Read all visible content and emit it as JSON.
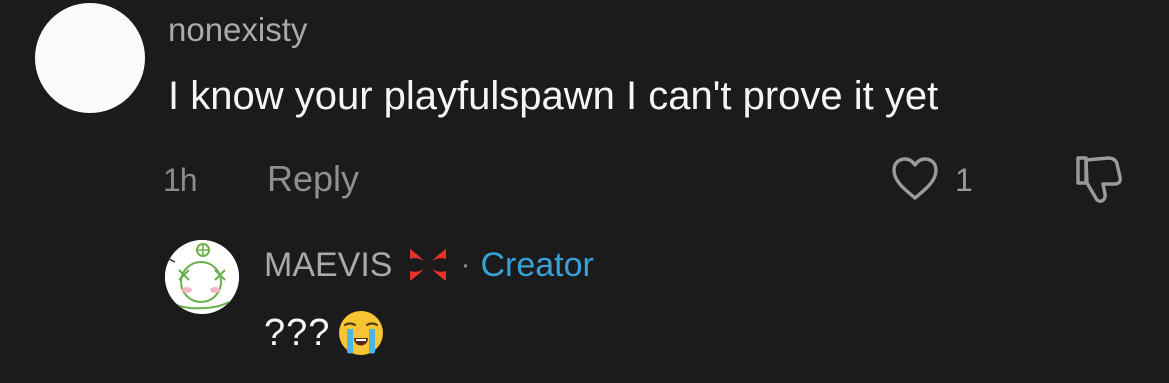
{
  "comment": {
    "username": "nonexisty",
    "text": "I know your playfulspawn I can't prove it yet",
    "time": "1h",
    "reply_label": "Reply",
    "like_count": "1",
    "avatar_color": "#fafafa"
  },
  "reply": {
    "username": "MAEVIS",
    "separator": "·",
    "badge": "Creator",
    "badge_color": "#3aa0d8",
    "text": "???",
    "username_emoji": "anger-symbol-icon",
    "text_emoji": "loudly-crying-face-icon"
  },
  "colors": {
    "background": "#1b1b1b",
    "primary_text": "#f5f5f5",
    "secondary_text": "#a9a9a9"
  }
}
